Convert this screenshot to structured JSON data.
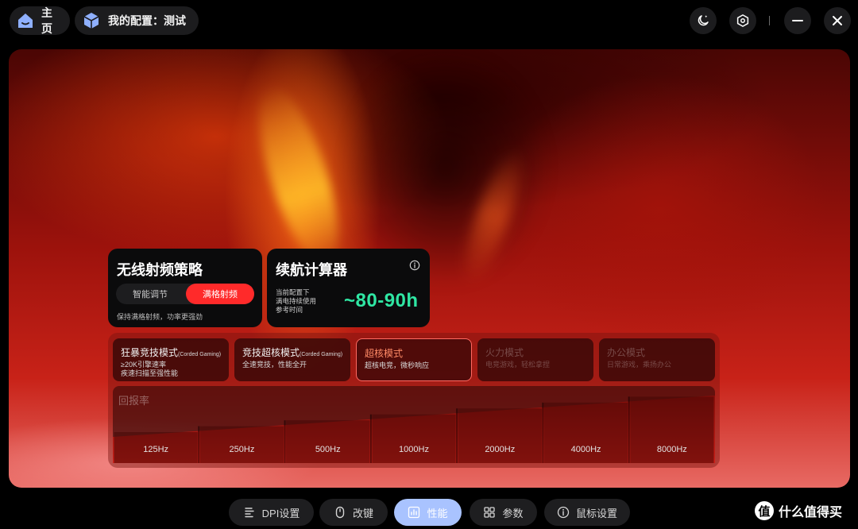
{
  "header": {
    "home_label": "主页",
    "config_label": "我的配置：测试"
  },
  "rf_strategy": {
    "title": "无线射频策略",
    "options": [
      "智能调节",
      "满格射频"
    ],
    "selected": "满格射频",
    "hint": "保持满格射频，功率更强劲"
  },
  "battery": {
    "title": "续航计算器",
    "desc_lines": [
      "当前配置下",
      "满电持续使用",
      "参考时间"
    ],
    "value": "~80-90h",
    "value_color": "#2fe6a3"
  },
  "modes": [
    {
      "title": "狂暴竞技模式",
      "tag": "(Corded Gaming)",
      "desc": "≥20K引擎速率\n疾速扫描至强性能",
      "state": "normal"
    },
    {
      "title": "竞技超核模式",
      "tag": "(Corded Gaming)",
      "desc": "全速竞技，性能全开",
      "state": "normal"
    },
    {
      "title": "超核模式",
      "tag": "",
      "desc": "超核电竞，微秒响应",
      "state": "selected"
    },
    {
      "title": "火力模式",
      "tag": "",
      "desc": "电竞游戏，轻松拿捏",
      "state": "disabled"
    },
    {
      "title": "办公模式",
      "tag": "",
      "desc": "日常游戏，乘扬办公",
      "state": "disabled"
    }
  ],
  "polling_rate": {
    "label": "回报率",
    "options": [
      "125Hz",
      "250Hz",
      "500Hz",
      "1000Hz",
      "2000Hz",
      "4000Hz",
      "8000Hz"
    ]
  },
  "bottom_nav": {
    "items": [
      {
        "label": "DPI设置",
        "icon": "list-icon",
        "active": false
      },
      {
        "label": "改键",
        "icon": "mouse-icon",
        "active": false
      },
      {
        "label": "性能",
        "icon": "chart-icon",
        "active": true
      },
      {
        "label": "参数",
        "icon": "grid-icon",
        "active": false
      },
      {
        "label": "鼠标设置",
        "icon": "info-icon",
        "active": false
      }
    ]
  },
  "watermark": {
    "logo_text": "值",
    "text": "什么值得买"
  },
  "colors": {
    "accent_red": "#ff2a2a",
    "selected_border": "#ff6a62",
    "active_nav": "#a9c3ff"
  }
}
